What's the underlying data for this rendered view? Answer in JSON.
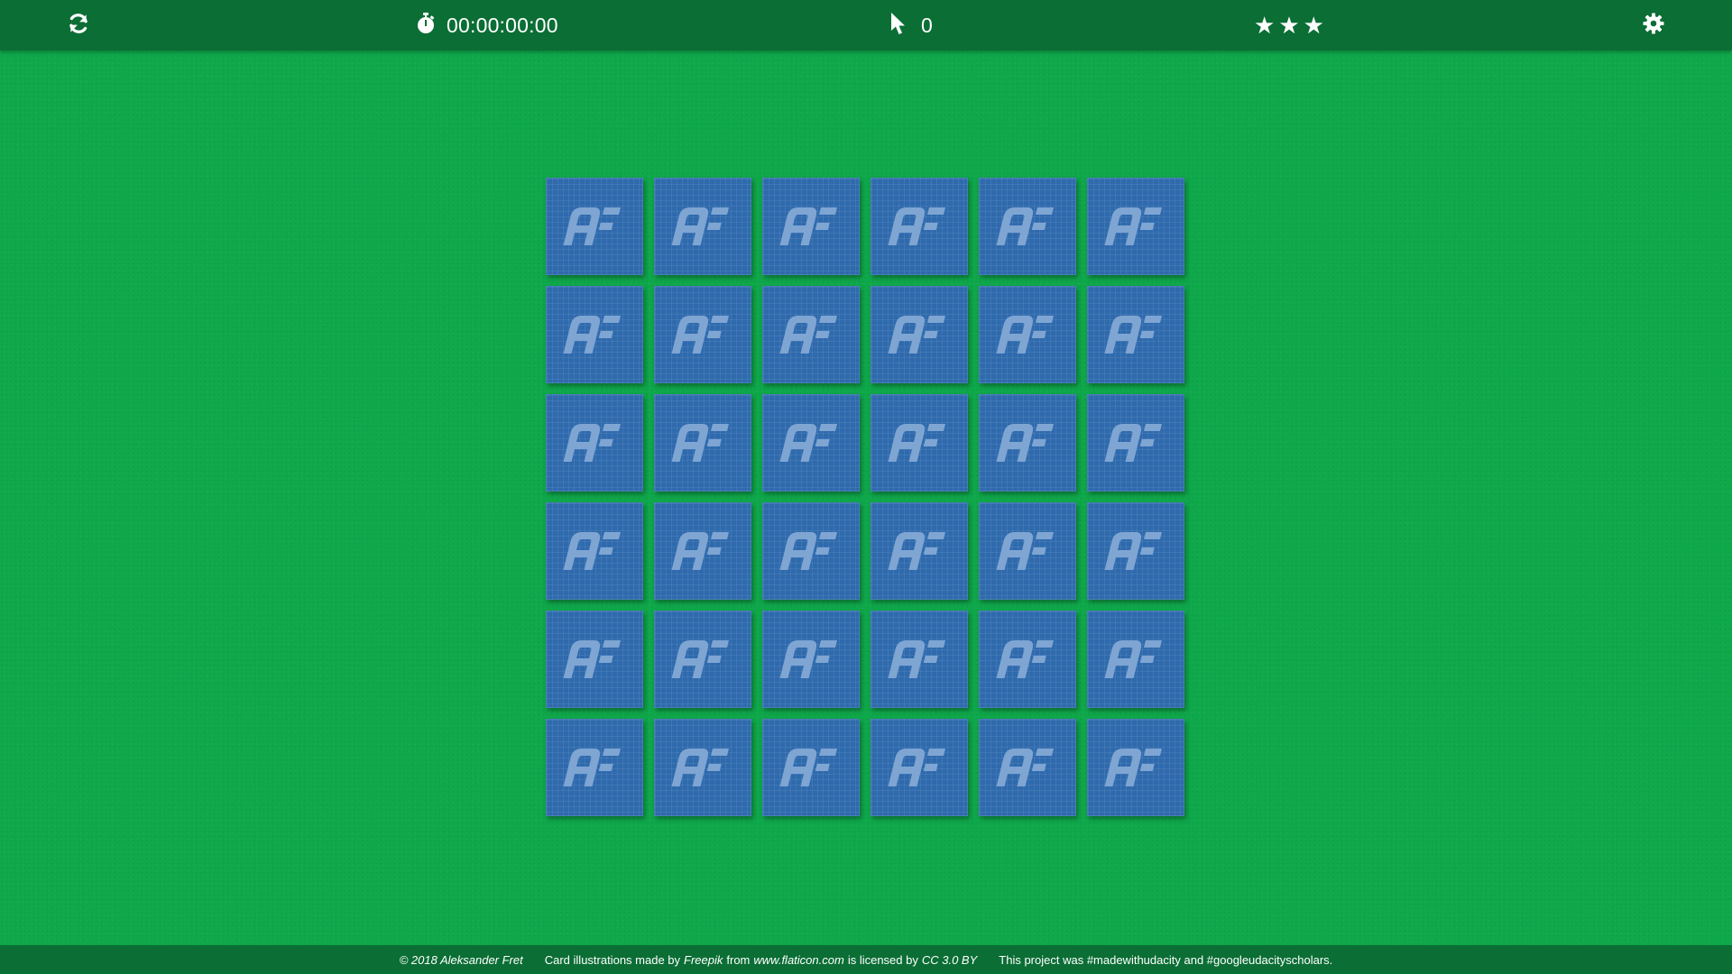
{
  "header": {
    "restart_icon": "refresh-icon",
    "timer": {
      "icon": "stopwatch-icon",
      "value": "00:00:00:00"
    },
    "moves": {
      "icon": "cursor-icon",
      "value": "0"
    },
    "stars": {
      "icon": "star-icon",
      "count": 3,
      "max": 3
    },
    "settings_icon": "gear-icon"
  },
  "board": {
    "rows": 6,
    "cols": 6,
    "card_back_logo": "AF",
    "state": "all-face-down"
  },
  "footer": {
    "copyright": "© 2018 Aleksander Fret",
    "credit_prefix": "Card illustrations made by",
    "credit_author": "Freepik",
    "credit_from": "from",
    "credit_site": "www.flaticon.com",
    "credit_license_text": "is licensed by",
    "credit_license": "CC 3.0 BY",
    "project_note": "This project was #madewithudacity and #googleudacityscholars."
  },
  "colors": {
    "table_green": "#0fa84b",
    "bar_green": "#0b6e35",
    "card_blue": "#2f6aad",
    "logo_blue": "#7fa5d3"
  }
}
